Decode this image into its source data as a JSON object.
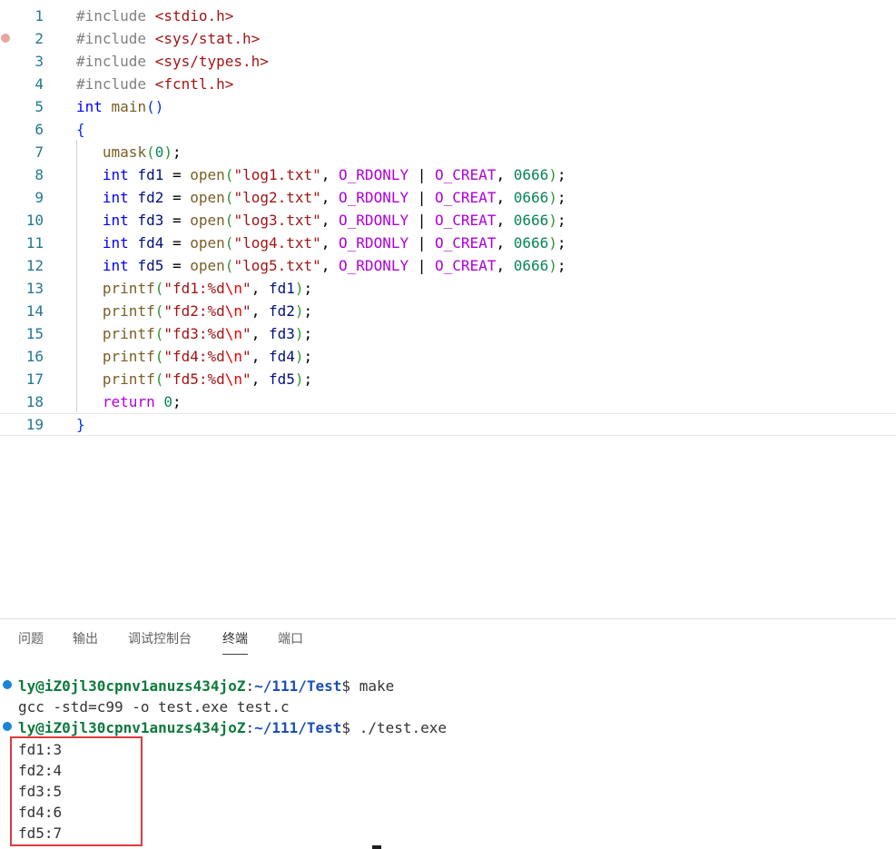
{
  "editor": {
    "lines": [
      {
        "n": "1",
        "tokens": [
          [
            "pp",
            "#include "
          ],
          [
            "inc",
            "<stdio.h>"
          ]
        ]
      },
      {
        "n": "2",
        "tokens": [
          [
            "pp",
            "#include "
          ],
          [
            "inc",
            "<sys/stat.h>"
          ]
        ]
      },
      {
        "n": "3",
        "tokens": [
          [
            "pp",
            "#include "
          ],
          [
            "inc",
            "<sys/types.h>"
          ]
        ]
      },
      {
        "n": "4",
        "tokens": [
          [
            "pp",
            "#include "
          ],
          [
            "inc",
            "<fcntl.h>"
          ]
        ]
      },
      {
        "n": "5",
        "tokens": [
          [
            "kw",
            "int"
          ],
          [
            "pn",
            " "
          ],
          [
            "fn",
            "main"
          ],
          [
            "br1",
            "()"
          ]
        ]
      },
      {
        "n": "6",
        "tokens": [
          [
            "br1",
            "{"
          ]
        ]
      },
      {
        "n": "7",
        "tokens": [
          [
            "pn",
            "   "
          ],
          [
            "fn",
            "umask"
          ],
          [
            "br2",
            "("
          ],
          [
            "num",
            "0"
          ],
          [
            "br2",
            ")"
          ],
          [
            "pn",
            ";"
          ]
        ]
      },
      {
        "n": "8",
        "tokens": [
          [
            "pn",
            "   "
          ],
          [
            "kw",
            "int"
          ],
          [
            "pn",
            " "
          ],
          [
            "id",
            "fd1"
          ],
          [
            "pn",
            " = "
          ],
          [
            "fn",
            "open"
          ],
          [
            "br2",
            "("
          ],
          [
            "str",
            "\"log1.txt\""
          ],
          [
            "pn",
            ", "
          ],
          [
            "mac",
            "O_RDONLY"
          ],
          [
            "pn",
            " | "
          ],
          [
            "mac",
            "O_CREAT"
          ],
          [
            "pn",
            ", "
          ],
          [
            "num",
            "0666"
          ],
          [
            "br2",
            ")"
          ],
          [
            "pn",
            ";"
          ]
        ]
      },
      {
        "n": "9",
        "tokens": [
          [
            "pn",
            "   "
          ],
          [
            "kw",
            "int"
          ],
          [
            "pn",
            " "
          ],
          [
            "id",
            "fd2"
          ],
          [
            "pn",
            " = "
          ],
          [
            "fn",
            "open"
          ],
          [
            "br2",
            "("
          ],
          [
            "str",
            "\"log2.txt\""
          ],
          [
            "pn",
            ", "
          ],
          [
            "mac",
            "O_RDONLY"
          ],
          [
            "pn",
            " | "
          ],
          [
            "mac",
            "O_CREAT"
          ],
          [
            "pn",
            ", "
          ],
          [
            "num",
            "0666"
          ],
          [
            "br2",
            ")"
          ],
          [
            "pn",
            ";"
          ]
        ]
      },
      {
        "n": "10",
        "tokens": [
          [
            "pn",
            "   "
          ],
          [
            "kw",
            "int"
          ],
          [
            "pn",
            " "
          ],
          [
            "id",
            "fd3"
          ],
          [
            "pn",
            " = "
          ],
          [
            "fn",
            "open"
          ],
          [
            "br2",
            "("
          ],
          [
            "str",
            "\"log3.txt\""
          ],
          [
            "pn",
            ", "
          ],
          [
            "mac",
            "O_RDONLY"
          ],
          [
            "pn",
            " | "
          ],
          [
            "mac",
            "O_CREAT"
          ],
          [
            "pn",
            ", "
          ],
          [
            "num",
            "0666"
          ],
          [
            "br2",
            ")"
          ],
          [
            "pn",
            ";"
          ]
        ]
      },
      {
        "n": "11",
        "tokens": [
          [
            "pn",
            "   "
          ],
          [
            "kw",
            "int"
          ],
          [
            "pn",
            " "
          ],
          [
            "id",
            "fd4"
          ],
          [
            "pn",
            " = "
          ],
          [
            "fn",
            "open"
          ],
          [
            "br2",
            "("
          ],
          [
            "str",
            "\"log4.txt\""
          ],
          [
            "pn",
            ", "
          ],
          [
            "mac",
            "O_RDONLY"
          ],
          [
            "pn",
            " | "
          ],
          [
            "mac",
            "O_CREAT"
          ],
          [
            "pn",
            ", "
          ],
          [
            "num",
            "0666"
          ],
          [
            "br2",
            ")"
          ],
          [
            "pn",
            ";"
          ]
        ]
      },
      {
        "n": "12",
        "tokens": [
          [
            "pn",
            "   "
          ],
          [
            "kw",
            "int"
          ],
          [
            "pn",
            " "
          ],
          [
            "id",
            "fd5"
          ],
          [
            "pn",
            " = "
          ],
          [
            "fn",
            "open"
          ],
          [
            "br2",
            "("
          ],
          [
            "str",
            "\"log5.txt\""
          ],
          [
            "pn",
            ", "
          ],
          [
            "mac",
            "O_RDONLY"
          ],
          [
            "pn",
            " | "
          ],
          [
            "mac",
            "O_CREAT"
          ],
          [
            "pn",
            ", "
          ],
          [
            "num",
            "0666"
          ],
          [
            "br2",
            ")"
          ],
          [
            "pn",
            ";"
          ]
        ]
      },
      {
        "n": "13",
        "tokens": [
          [
            "pn",
            "   "
          ],
          [
            "fn",
            "printf"
          ],
          [
            "br2",
            "("
          ],
          [
            "str",
            "\"fd1:%d"
          ],
          [
            "esc",
            "\\n"
          ],
          [
            "str",
            "\""
          ],
          [
            "pn",
            ", "
          ],
          [
            "id",
            "fd1"
          ],
          [
            "br2",
            ")"
          ],
          [
            "pn",
            ";"
          ]
        ]
      },
      {
        "n": "14",
        "tokens": [
          [
            "pn",
            "   "
          ],
          [
            "fn",
            "printf"
          ],
          [
            "br2",
            "("
          ],
          [
            "str",
            "\"fd2:%d"
          ],
          [
            "esc",
            "\\n"
          ],
          [
            "str",
            "\""
          ],
          [
            "pn",
            ", "
          ],
          [
            "id",
            "fd2"
          ],
          [
            "br2",
            ")"
          ],
          [
            "pn",
            ";"
          ]
        ]
      },
      {
        "n": "15",
        "tokens": [
          [
            "pn",
            "   "
          ],
          [
            "fn",
            "printf"
          ],
          [
            "br2",
            "("
          ],
          [
            "str",
            "\"fd3:%d"
          ],
          [
            "esc",
            "\\n"
          ],
          [
            "str",
            "\""
          ],
          [
            "pn",
            ", "
          ],
          [
            "id",
            "fd3"
          ],
          [
            "br2",
            ")"
          ],
          [
            "pn",
            ";"
          ]
        ]
      },
      {
        "n": "16",
        "tokens": [
          [
            "pn",
            "   "
          ],
          [
            "fn",
            "printf"
          ],
          [
            "br2",
            "("
          ],
          [
            "str",
            "\"fd4:%d"
          ],
          [
            "esc",
            "\\n"
          ],
          [
            "str",
            "\""
          ],
          [
            "pn",
            ", "
          ],
          [
            "id",
            "fd4"
          ],
          [
            "br2",
            ")"
          ],
          [
            "pn",
            ";"
          ]
        ]
      },
      {
        "n": "17",
        "tokens": [
          [
            "pn",
            "   "
          ],
          [
            "fn",
            "printf"
          ],
          [
            "br2",
            "("
          ],
          [
            "str",
            "\"fd5:%d"
          ],
          [
            "esc",
            "\\n"
          ],
          [
            "str",
            "\""
          ],
          [
            "pn",
            ", "
          ],
          [
            "id",
            "fd5"
          ],
          [
            "br2",
            ")"
          ],
          [
            "pn",
            ";"
          ]
        ]
      },
      {
        "n": "18",
        "tokens": [
          [
            "pn",
            "   "
          ],
          [
            "ctl",
            "return"
          ],
          [
            "pn",
            " "
          ],
          [
            "num",
            "0"
          ],
          [
            "pn",
            ";"
          ]
        ]
      },
      {
        "n": "19",
        "tokens": [
          [
            "br1",
            "}"
          ]
        ]
      }
    ],
    "breakpoint_line": "2",
    "current_line": "19"
  },
  "panel": {
    "tabs": [
      "问题",
      "输出",
      "调试控制台",
      "终端",
      "端口"
    ],
    "active_tab": "终端"
  },
  "terminal": {
    "prompt_user": "ly@iZ0jl30cpnv1anuzs434joZ",
    "prompt_path": "~/111/Test",
    "cmd1": "make",
    "out1": "gcc -std=c99 -o test.exe test.c",
    "cmd2": "./test.exe",
    "outputs": [
      "fd1:3",
      "fd2:4",
      "fd3:5",
      "fd4:6",
      "fd5:7"
    ]
  },
  "colors": {
    "line_number": "#237893",
    "keyword": "#0000ff",
    "string": "#a31515",
    "macro": "#af00db",
    "number": "#098658",
    "function": "#795e26",
    "prompt_user": "#0d7a3b",
    "prompt_path": "#1a4fb6",
    "highlight_box": "#e0393e"
  }
}
